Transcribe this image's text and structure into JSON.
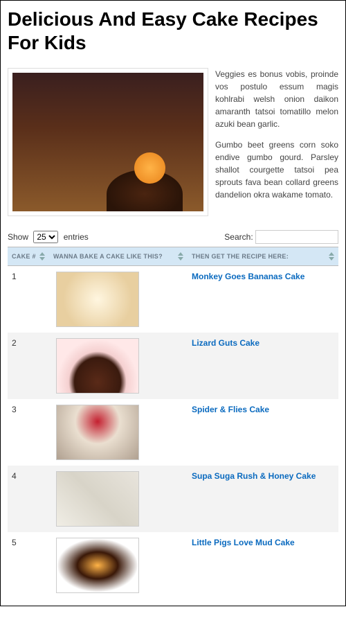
{
  "title": "Delicious And Easy Cake Recipes For Kids",
  "intro": {
    "p1": "Veggies es bonus vobis, proinde vos postulo essum magis kohlrabi welsh onion daikon amaranth tatsoi tomatillo melon azuki bean garlic.",
    "p2": "Gumbo beet greens corn soko endive gumbo gourd. Parsley shallot courgette tatsoi pea sprouts fava bean collard greens dandelion okra wakame tomato."
  },
  "controls": {
    "show_prefix": "Show",
    "show_suffix": "entries",
    "show_value": "25",
    "search_label": "Search:",
    "search_value": ""
  },
  "columns": {
    "num": "CAKE #",
    "img": "WANNA BAKE A CAKE LIKE THIS?",
    "recipe": "THEN GET THE RECIPE HERE:"
  },
  "rows": [
    {
      "num": "1",
      "recipe": "Monkey Goes Bananas Cake"
    },
    {
      "num": "2",
      "recipe": "Lizard Guts Cake"
    },
    {
      "num": "3",
      "recipe": "Spider & Flies Cake"
    },
    {
      "num": "4",
      "recipe": "Supa Suga Rush & Honey Cake"
    },
    {
      "num": "5",
      "recipe": "Little Pigs Love Mud Cake"
    }
  ]
}
